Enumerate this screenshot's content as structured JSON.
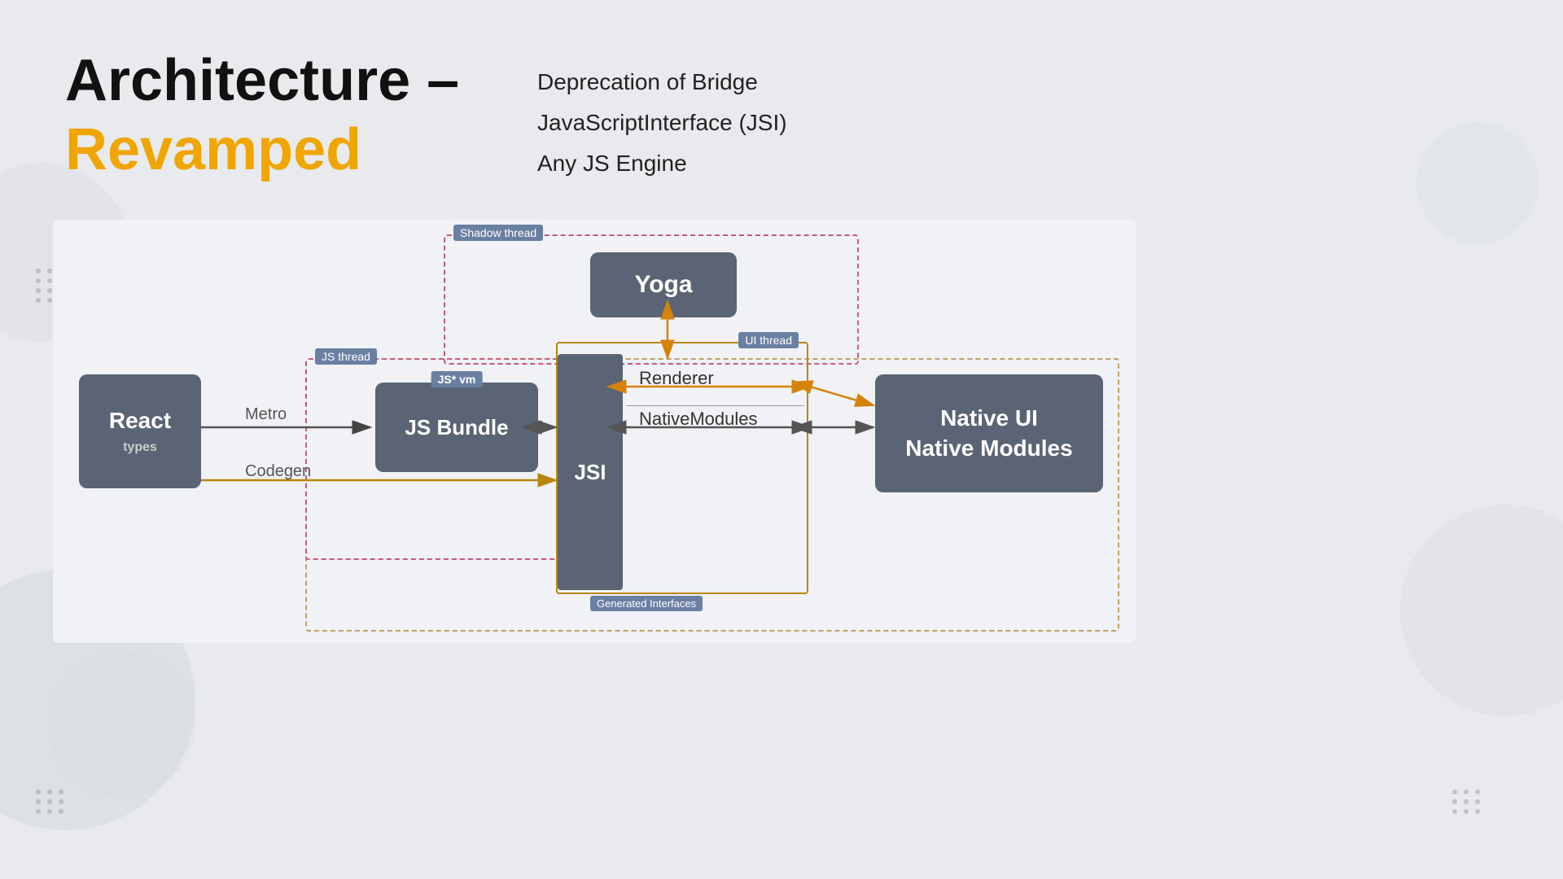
{
  "header": {
    "title_architecture": "Architecture –",
    "title_revamped": "Revamped"
  },
  "bullets": [
    "Deprecation of Bridge",
    "JavaScriptInterface (JSI)",
    "Any JS Engine"
  ],
  "diagram": {
    "shadow_thread": "Shadow thread",
    "js_thread": "JS thread",
    "ui_thread": "UI thread",
    "yoga_label": "Yoga",
    "react_label": "React",
    "react_types": "types",
    "metro_label": "Metro",
    "codegen_label": "Codegen",
    "jsbundle_label": "JS Bundle",
    "jsvm_label": "JS* vm",
    "jsi_label": "JSI",
    "renderer_label": "Renderer",
    "native_modules_label": "NativeModules",
    "generated_interfaces": "Generated Interfaces",
    "native_ui_label": "Native UI",
    "native_modules_right": "Native Modules"
  }
}
